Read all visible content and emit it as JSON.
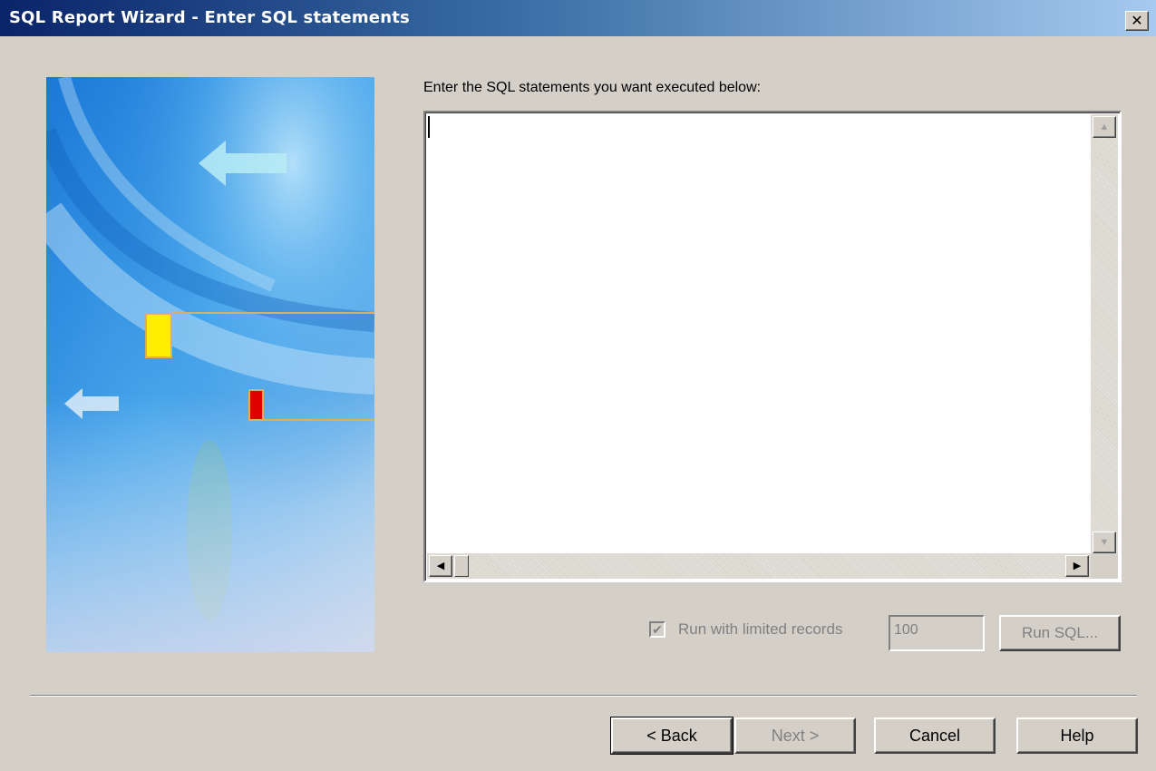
{
  "window": {
    "title": "SQL Report Wizard - Enter SQL statements",
    "close_glyph": "✕"
  },
  "main": {
    "prompt": "Enter the SQL statements you want executed below:",
    "sql_text": ""
  },
  "scrollbars": {
    "up_arrow": "▲",
    "down_arrow": "▼",
    "left_arrow": "◀",
    "right_arrow": "▶"
  },
  "limit": {
    "checked": true,
    "check_glyph": "✔",
    "label": "Run with limited records",
    "value": "100"
  },
  "buttons": {
    "run_sql": "Run SQL...",
    "back": "< Back",
    "next": "Next >",
    "cancel": "Cancel",
    "help": "Help"
  },
  "colors": {
    "titlebar_start": "#0a246a",
    "titlebar_end": "#a6caf0",
    "dialog_bg": "#d4d0c8",
    "marker_yellow": "#ffee00",
    "marker_red": "#e00000"
  }
}
